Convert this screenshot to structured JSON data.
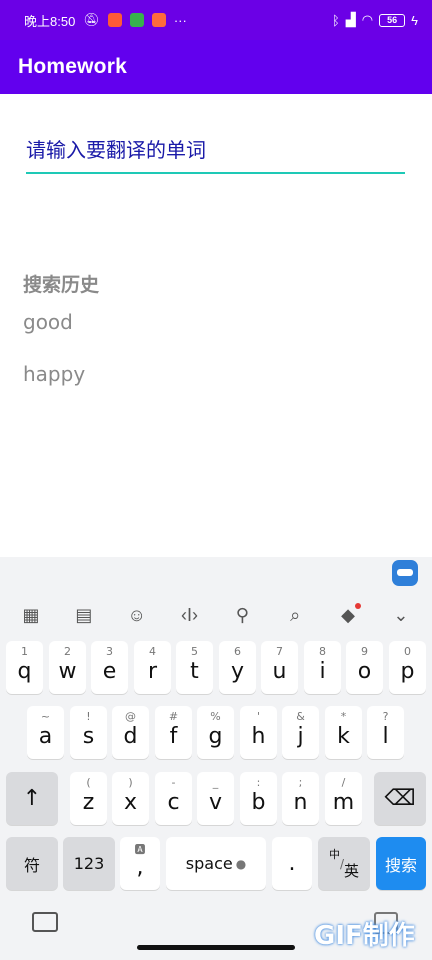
{
  "status_bar": {
    "time": "晚上8:50",
    "battery": "56",
    "icons": [
      "alarm-off-icon",
      "app-notification-icon",
      "more-dots-icon",
      "bluetooth-icon",
      "signal-icon",
      "wifi-icon",
      "charging-icon"
    ],
    "colors": {
      "bg": "#6b00e6"
    }
  },
  "toolbar": {
    "title": "Homework",
    "color": "#6200ee"
  },
  "search": {
    "placeholder": "请输入要翻译的单词",
    "value": ""
  },
  "history": {
    "title": "搜索历史",
    "items": [
      "good",
      "happy"
    ]
  },
  "keyboard": {
    "row1": [
      {
        "hint": "1",
        "label": "q"
      },
      {
        "hint": "2",
        "label": "w"
      },
      {
        "hint": "3",
        "label": "e"
      },
      {
        "hint": "4",
        "label": "r"
      },
      {
        "hint": "5",
        "label": "t"
      },
      {
        "hint": "6",
        "label": "y"
      },
      {
        "hint": "7",
        "label": "u"
      },
      {
        "hint": "8",
        "label": "i"
      },
      {
        "hint": "9",
        "label": "o"
      },
      {
        "hint": "0",
        "label": "p"
      }
    ],
    "row2": [
      {
        "hint": "~",
        "label": "a"
      },
      {
        "hint": "!",
        "label": "s"
      },
      {
        "hint": "@",
        "label": "d"
      },
      {
        "hint": "#",
        "label": "f"
      },
      {
        "hint": "%",
        "label": "g"
      },
      {
        "hint": "'",
        "label": "h"
      },
      {
        "hint": "&",
        "label": "j"
      },
      {
        "hint": "*",
        "label": "k"
      },
      {
        "hint": "?",
        "label": "l"
      }
    ],
    "row3": [
      {
        "hint": "(",
        "label": "z"
      },
      {
        "hint": ")",
        "label": "x"
      },
      {
        "hint": "-",
        "label": "c"
      },
      {
        "hint": "_",
        "label": "v"
      },
      {
        "hint": ":",
        "label": "b"
      },
      {
        "hint": ";",
        "label": "n"
      },
      {
        "hint": "/",
        "label": "m"
      }
    ],
    "shift": "↑",
    "backspace": "⌫",
    "symbol": "符",
    "numbers": "123",
    "comma": ",",
    "space": "space",
    "period": ".",
    "lang_top": "中",
    "lang_bottom": "英",
    "search": "搜索",
    "search_color": "#1e8cf0"
  },
  "watermark": "GIF制作"
}
